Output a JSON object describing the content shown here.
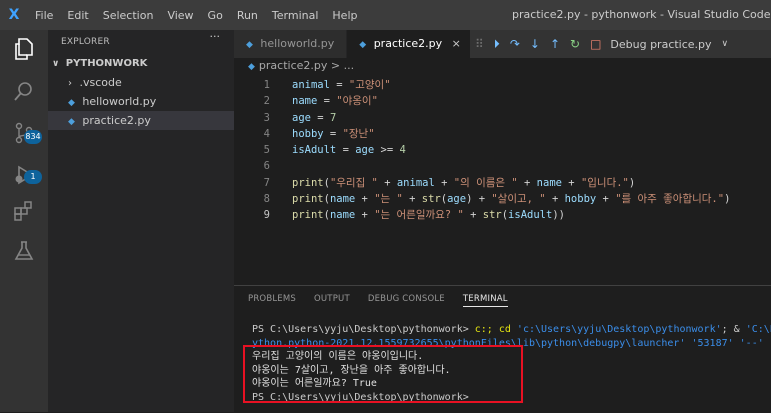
{
  "titlebar": {
    "logo": "X",
    "menu": [
      "File",
      "Edit",
      "Selection",
      "View",
      "Go",
      "Run",
      "Terminal",
      "Help"
    ],
    "window_title": "practice2.py - pythonwork - Visual Studio Code"
  },
  "activity": {
    "icons": [
      "files-icon",
      "search-icon",
      "source-control-icon",
      "run-debug-icon",
      "extensions-icon",
      "testing-icon"
    ],
    "scm_badge": "834",
    "debug_badge": "1"
  },
  "sidebar": {
    "header": "EXPLORER",
    "more": "···",
    "root": "PYTHONWORK",
    "items": [
      {
        "label": ".vscode"
      },
      {
        "label": "helloworld.py"
      },
      {
        "label": "practice2.py"
      }
    ]
  },
  "editor": {
    "tabs": [
      {
        "label": "helloworld.py"
      },
      {
        "label": "practice2.py",
        "close": "×"
      }
    ],
    "debug_config": "Debug practice.py",
    "breadcrumb": "practice2.py > ...",
    "lines": [
      {
        "n": "1",
        "seg": [
          [
            "kw",
            "animal"
          ],
          [
            "op",
            " = "
          ],
          [
            "str",
            "\"고양이\""
          ]
        ]
      },
      {
        "n": "2",
        "seg": [
          [
            "kw",
            "name"
          ],
          [
            "op",
            " = "
          ],
          [
            "str",
            "\"야옹이\""
          ]
        ]
      },
      {
        "n": "3",
        "seg": [
          [
            "kw",
            "age"
          ],
          [
            "op",
            " = "
          ],
          [
            "num",
            "7"
          ]
        ]
      },
      {
        "n": "4",
        "seg": [
          [
            "kw",
            "hobby"
          ],
          [
            "op",
            " = "
          ],
          [
            "str",
            "\"장난\""
          ]
        ]
      },
      {
        "n": "5",
        "seg": [
          [
            "kw",
            "isAdult"
          ],
          [
            "op",
            " = "
          ],
          [
            "kw",
            "age"
          ],
          [
            "op",
            " >= "
          ],
          [
            "num",
            "4"
          ]
        ]
      },
      {
        "n": "6",
        "seg": []
      },
      {
        "n": "7",
        "seg": [
          [
            "fn",
            "print"
          ],
          [
            "op",
            "("
          ],
          [
            "str",
            "\"우리집 \""
          ],
          [
            "op",
            " + "
          ],
          [
            "kw",
            "animal"
          ],
          [
            "op",
            " + "
          ],
          [
            "str",
            "\"의 이름은 \""
          ],
          [
            "op",
            " + "
          ],
          [
            "kw",
            "name"
          ],
          [
            "op",
            " + "
          ],
          [
            "str",
            "\"입니다.\""
          ],
          [
            "op",
            ")"
          ]
        ]
      },
      {
        "n": "8",
        "seg": [
          [
            "fn",
            "print"
          ],
          [
            "op",
            "("
          ],
          [
            "kw",
            "name"
          ],
          [
            "op",
            " + "
          ],
          [
            "str",
            "\"는 \""
          ],
          [
            "op",
            " + "
          ],
          [
            "fn",
            "str"
          ],
          [
            "op",
            "("
          ],
          [
            "kw",
            "age"
          ],
          [
            "op",
            ") + "
          ],
          [
            "str",
            "\"살이고, \""
          ],
          [
            "op",
            " + "
          ],
          [
            "kw",
            "hobby"
          ],
          [
            "op",
            " + "
          ],
          [
            "str",
            "\"를 아주 좋아합니다.\""
          ],
          [
            "op",
            ")"
          ]
        ]
      },
      {
        "n": "9",
        "seg": [
          [
            "fn",
            "print"
          ],
          [
            "op",
            "("
          ],
          [
            "kw",
            "name"
          ],
          [
            "op",
            " + "
          ],
          [
            "str",
            "\"는 어른일까요? \""
          ],
          [
            "op",
            " + "
          ],
          [
            "fn",
            "str"
          ],
          [
            "op",
            "("
          ],
          [
            "kw",
            "isAdult"
          ],
          [
            "op",
            "))"
          ]
        ]
      }
    ]
  },
  "panel": {
    "tabs": [
      "PROBLEMS",
      "OUTPUT",
      "DEBUG CONSOLE",
      "TERMINAL"
    ],
    "active_tab": "TERMINAL",
    "term": {
      "prompt": "PS C:\\Users\\yyju\\Desktop\\pythonwork>",
      "cmd_a": " c:; cd ",
      "path1": "'c:\\Users\\yyju\\Desktop\\pythonwork'",
      "cmd_b": "; & ",
      "path2": "'C:\\P",
      "line2": "ython.python-2021.12.1559732655\\pythonFiles\\lib\\python\\debugpy\\launcher' '53187' '--' 'c",
      "out1": "우리집 고양이의 이름은 야옹이입니다.",
      "out2": "야옹이는 7살이고, 장난을 아주 좋아합니다.",
      "out3": "야옹이는 어른일까요? True",
      "last_prompt": "PS C:\\Users\\yyju\\Desktop\\pythonwork>"
    }
  }
}
